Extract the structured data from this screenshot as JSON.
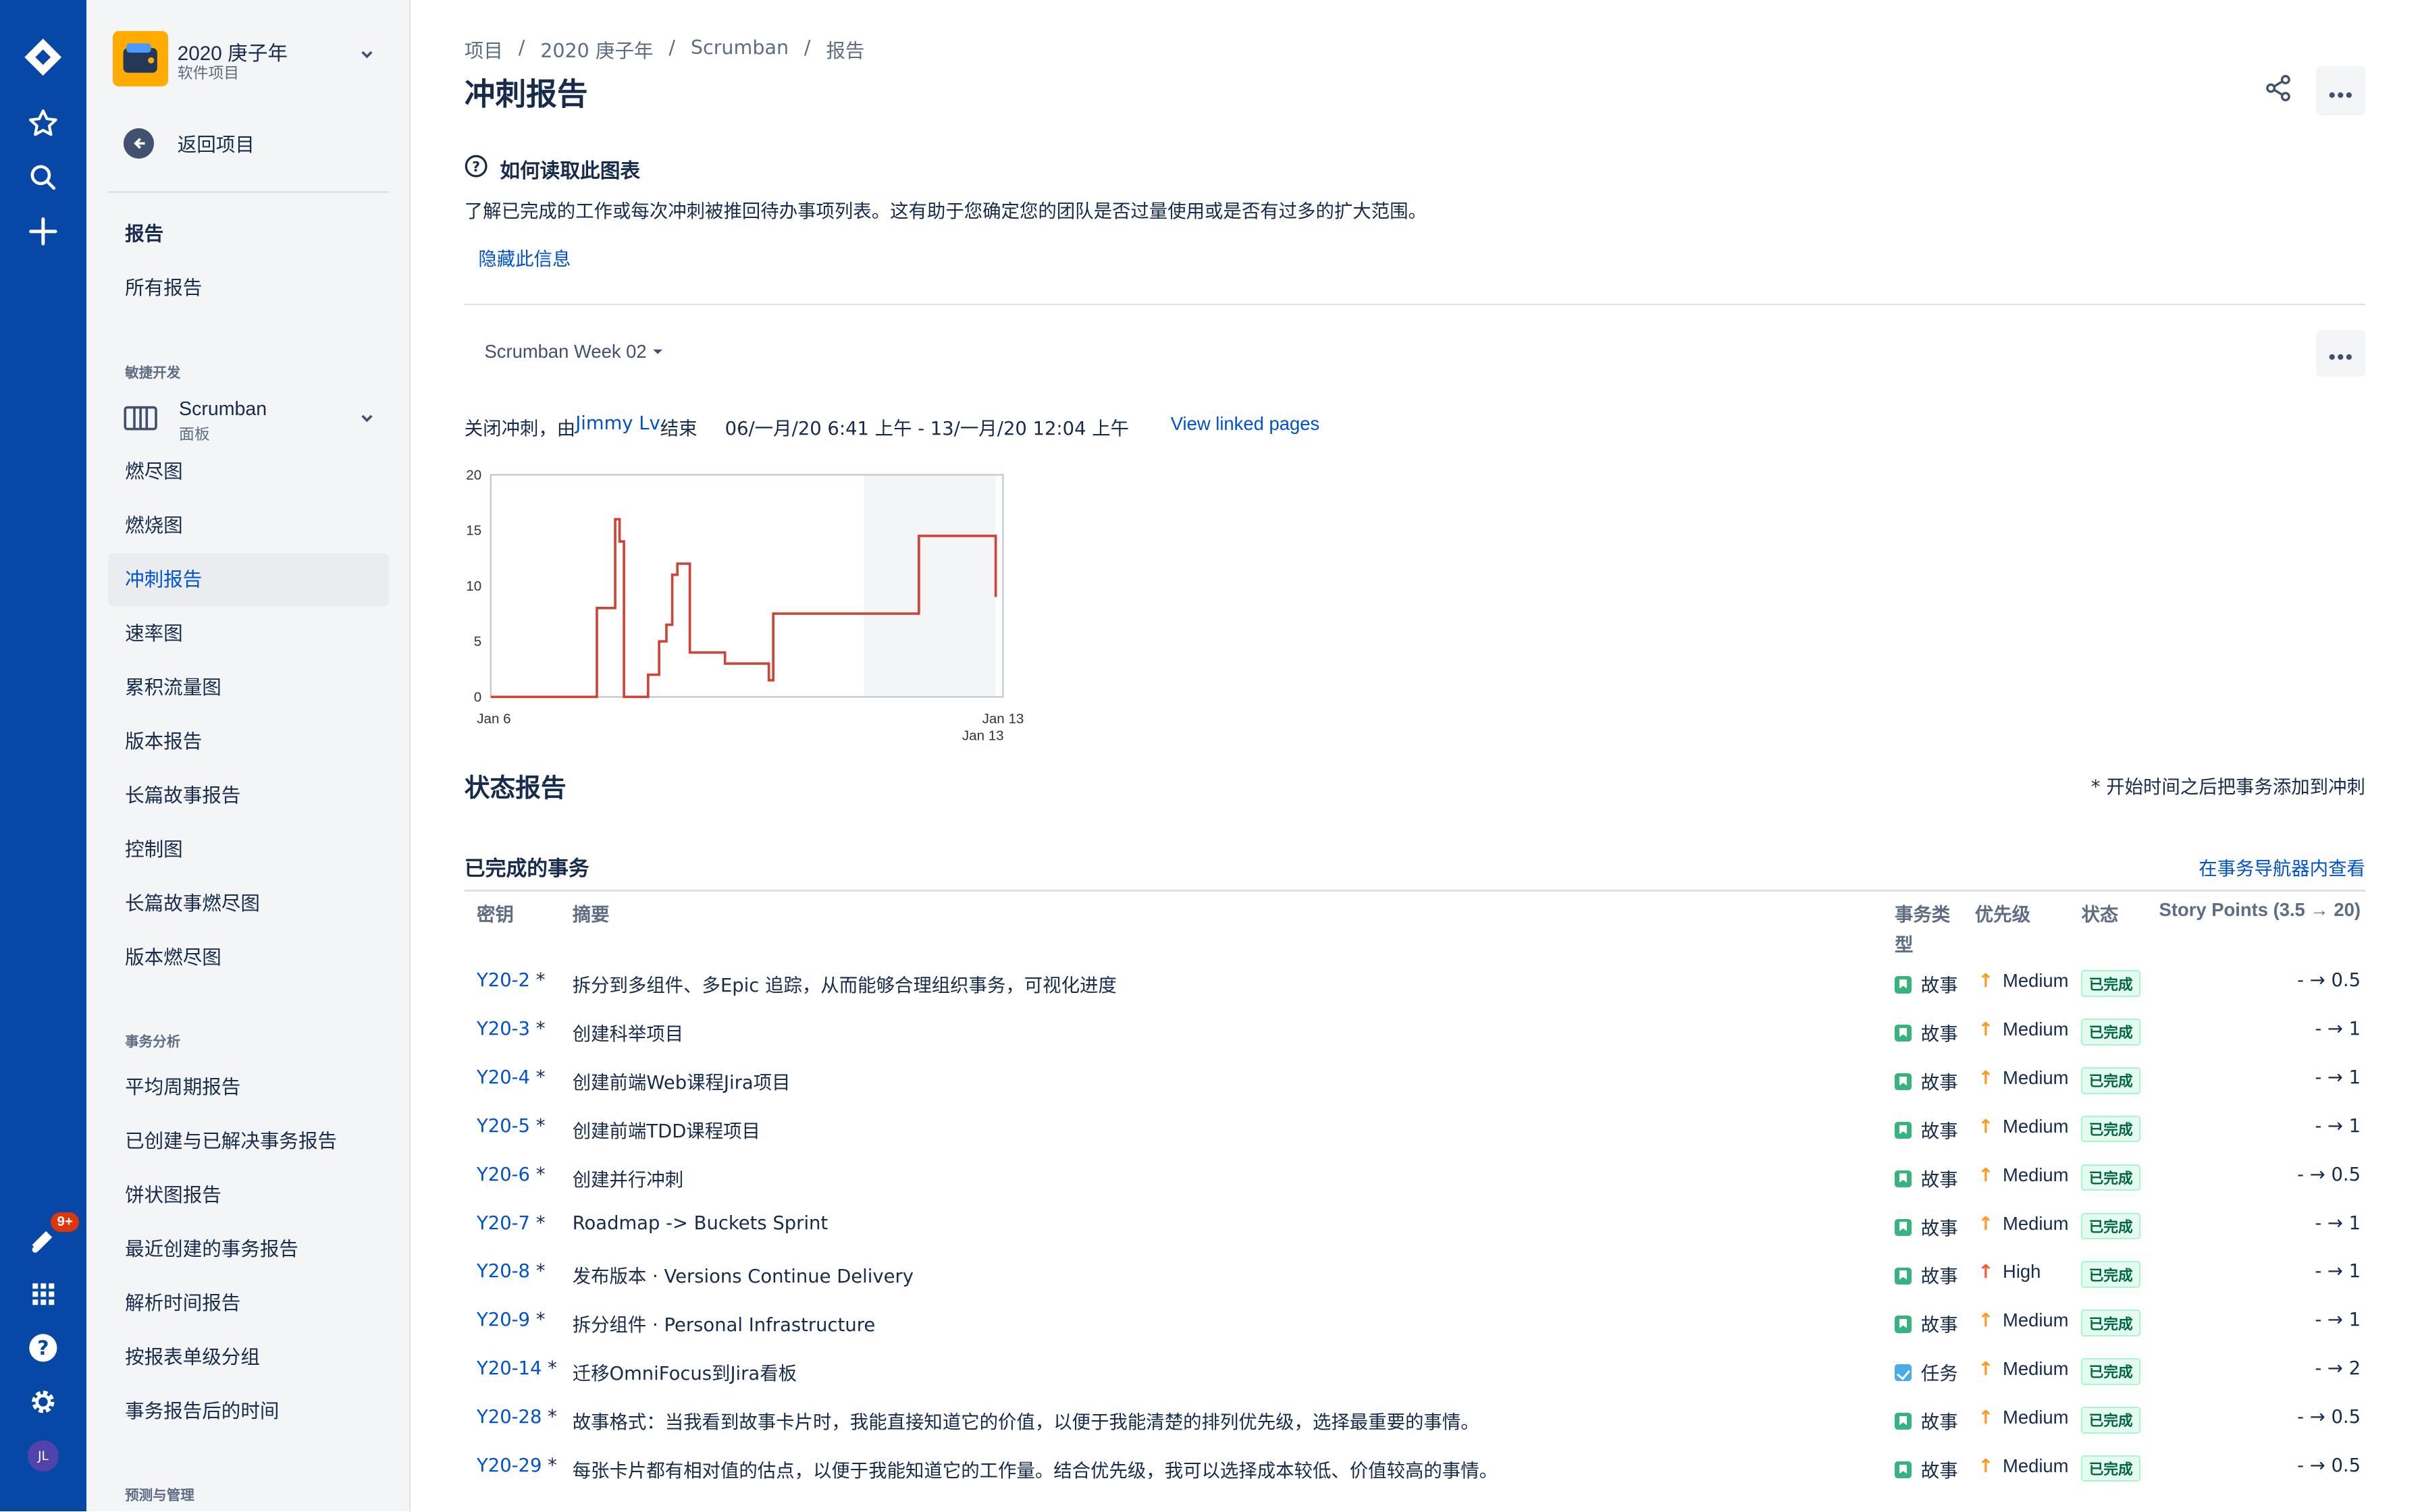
{
  "sidebar": {
    "project_name": "2020 庚子年",
    "project_type": "软件项目",
    "back_label": "返回项目",
    "reports_heading": "报告",
    "all_reports": "所有报告",
    "agile_group": "敏捷开发",
    "board_name": "Scrumban",
    "board_type": "面板",
    "agile_items": [
      "燃尽图",
      "燃烧图",
      "冲刺报告",
      "速率图",
      "累积流量图",
      "版本报告",
      "长篇故事报告",
      "控制图",
      "长篇故事燃尽图",
      "版本燃尽图"
    ],
    "analysis_group": "事务分析",
    "analysis_items": [
      "平均周期报告",
      "已创建与已解决事务报告",
      "饼状图报告",
      "最近创建的事务报告",
      "解析时间报告",
      "按报表单级分组",
      "事务报告后的时间"
    ],
    "forecast_group": "预测与管理"
  },
  "globalnav": {
    "notif_badge": "9+",
    "avatar": "JL"
  },
  "header": {
    "breadcrumbs": [
      "项目",
      "2020 庚子年",
      "Scrumban",
      "报告"
    ],
    "title": "冲刺报告"
  },
  "help": {
    "title": "如何读取此图表",
    "text": "了解已完成的工作或每次冲刺被推回待办事项列表。这有助于您确定您的团队是否过量使用或是否有过多的扩大范围。",
    "hide_label": "隐藏此信息"
  },
  "sprint": {
    "selected": "Scrumban Week 02",
    "closed_prefix": "关闭冲刺，由",
    "closed_by": "Jimmy Lv",
    "closed_suffix": "结束",
    "date_range": "06/一月/20 6:41 上午 - 13/一月/20 12:04 上午",
    "linked_pages": "View linked pages"
  },
  "chart_data": {
    "type": "line",
    "title": "",
    "ylim": [
      0,
      20
    ],
    "yticks": [
      "0",
      "5",
      "10",
      "15",
      "20"
    ],
    "xlabels": [
      "Jan 6",
      "Jan 13"
    ],
    "xlabel_secondary": "Jan 13",
    "x_range_days": [
      0,
      7
    ],
    "nonworking_shade_days": [
      5.1,
      6.9
    ],
    "series": [
      {
        "points": [
          [
            0,
            0
          ],
          [
            1.45,
            0
          ],
          [
            1.45,
            8
          ],
          [
            1.7,
            8
          ],
          [
            1.7,
            16
          ],
          [
            1.76,
            16
          ],
          [
            1.76,
            14
          ],
          [
            1.82,
            14
          ],
          [
            1.82,
            0
          ],
          [
            2.15,
            0
          ],
          [
            2.15,
            2
          ],
          [
            2.3,
            2
          ],
          [
            2.3,
            5
          ],
          [
            2.4,
            5
          ],
          [
            2.4,
            6.5
          ],
          [
            2.48,
            6.5
          ],
          [
            2.48,
            11
          ],
          [
            2.55,
            11
          ],
          [
            2.55,
            12
          ],
          [
            2.72,
            12
          ],
          [
            2.72,
            4
          ],
          [
            3.2,
            4
          ],
          [
            3.2,
            3
          ],
          [
            3.8,
            3
          ],
          [
            3.8,
            1.5
          ],
          [
            3.86,
            1.5
          ],
          [
            3.86,
            7.5
          ],
          [
            5.85,
            7.5
          ],
          [
            5.85,
            14.5
          ],
          [
            6.9,
            14.5
          ],
          [
            6.9,
            9
          ]
        ]
      }
    ],
    "color_line": "#D04437",
    "color_shade": "#F4F5F7"
  },
  "status": {
    "title": "状态报告",
    "note": "* 开始时间之后把事务添加到冲刺",
    "completed_title": "已完成的事务",
    "navigator_link": "在事务导航器内查看",
    "columns": {
      "key": "密钥",
      "summary": "摘要",
      "type_1": "事务类",
      "type_2": "型",
      "priority": "优先级",
      "status": "状态",
      "points": "Story Points (3.5 → 20)"
    },
    "rows": [
      {
        "key": "Y20-2",
        "mark": "*",
        "summary": "拆分到多组件、多Epic 追踪，从而能够合理组织事务，可视化进度",
        "type": "故事",
        "type_kind": "story",
        "priority": "Medium",
        "status": "已完成",
        "points": "- → 0.5"
      },
      {
        "key": "Y20-3",
        "mark": "*",
        "summary": "创建科举项目",
        "type": "故事",
        "type_kind": "story",
        "priority": "Medium",
        "status": "已完成",
        "points": "- → 1"
      },
      {
        "key": "Y20-4",
        "mark": "*",
        "summary": "创建前端Web课程Jira项目",
        "type": "故事",
        "type_kind": "story",
        "priority": "Medium",
        "status": "已完成",
        "points": "- → 1"
      },
      {
        "key": "Y20-5",
        "mark": "*",
        "summary": "创建前端TDD课程项目",
        "type": "故事",
        "type_kind": "story",
        "priority": "Medium",
        "status": "已完成",
        "points": "- → 1"
      },
      {
        "key": "Y20-6",
        "mark": "*",
        "summary": "创建并行冲刺",
        "type": "故事",
        "type_kind": "story",
        "priority": "Medium",
        "status": "已完成",
        "points": "- → 0.5"
      },
      {
        "key": "Y20-7",
        "mark": "*",
        "summary": "Roadmap -> Buckets Sprint",
        "type": "故事",
        "type_kind": "story",
        "priority": "Medium",
        "status": "已完成",
        "points": "- → 1"
      },
      {
        "key": "Y20-8",
        "mark": "*",
        "summary": "发布版本 · Versions Continue Delivery",
        "type": "故事",
        "type_kind": "story",
        "priority": "High",
        "status": "已完成",
        "points": "- → 1"
      },
      {
        "key": "Y20-9",
        "mark": "*",
        "summary": "拆分组件 · Personal Infrastructure",
        "type": "故事",
        "type_kind": "story",
        "priority": "Medium",
        "status": "已完成",
        "points": "- → 1"
      },
      {
        "key": "Y20-14",
        "mark": "*",
        "summary": "迁移OmniFocus到Jira看板",
        "type": "任务",
        "type_kind": "task",
        "priority": "Medium",
        "status": "已完成",
        "points": "- → 2"
      },
      {
        "key": "Y20-28",
        "mark": "*",
        "summary": "故事格式：当我看到故事卡片时，我能直接知道它的价值，以便于我能清楚的排列优先级，选择最重要的事情。",
        "type": "故事",
        "type_kind": "story",
        "priority": "Medium",
        "status": "已完成",
        "points": "- → 0.5"
      },
      {
        "key": "Y20-29",
        "mark": "*",
        "summary": "每张卡片都有相对值的估点，以便于我能知道它的工作量。结合优先级，我可以选择成本较低、价值较高的事情。",
        "type": "故事",
        "type_kind": "story",
        "priority": "Medium",
        "status": "已完成",
        "points": "- → 0.5"
      }
    ]
  },
  "colors": {
    "nav": "#0747A6",
    "link": "#0052CC",
    "medium": "#FF991F",
    "high": "#FF5630",
    "done": "#006644"
  }
}
